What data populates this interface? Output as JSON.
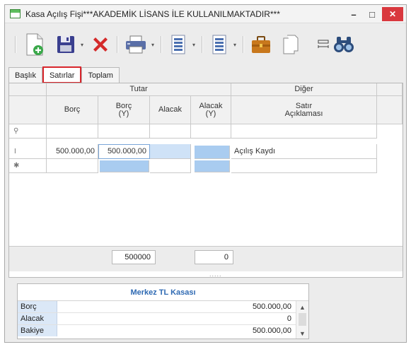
{
  "window": {
    "title": "Kasa Açılış Fişi***AKADEMİK LİSANS İLE KULLANILMAKTADIR***",
    "minimize": "–",
    "maximize": "□",
    "close": "✕"
  },
  "toolbar": {
    "icons": [
      "add-document-icon",
      "save-icon",
      "delete-icon",
      "print-icon",
      "document-list-icon",
      "document-list-icon",
      "briefcase-icon",
      "copy-icon",
      "ruler-icon",
      "binoculars-icon"
    ],
    "dropdown_glyph": "▾"
  },
  "tabs": [
    {
      "label": "Başlık",
      "active": false
    },
    {
      "label": "Satırlar",
      "active": true
    },
    {
      "label": "Toplam",
      "active": false
    }
  ],
  "grid": {
    "group_headers": {
      "tutar": "Tutar",
      "diger": "Diğer"
    },
    "columns": {
      "borc": "Borç",
      "borc_y": "Borç\n(Y)",
      "alacak": "Alacak",
      "alacak_y": "Alacak\n(Y)",
      "aciklama": "Satır\nAçıklaması"
    },
    "row_indicators": {
      "filter": "⚲",
      "editing": "I",
      "new": "✱"
    },
    "rows": [
      {
        "borc": "500.000,00",
        "borc_y": "500.000,00",
        "alacak": "",
        "alacak_y": "",
        "aciklama": "Açılış Kaydı"
      }
    ],
    "totals": {
      "borc_y": "500000",
      "alacak_y": "0"
    },
    "splitter": "....."
  },
  "bottom_panel": {
    "title": "Merkez TL Kasası",
    "rows": [
      {
        "label": "Borç",
        "value": "500.000,00"
      },
      {
        "label": "Alacak",
        "value": "0"
      },
      {
        "label": "Bakiye",
        "value": "500.000,00"
      }
    ],
    "scroll_up": "▲",
    "scroll_down": "▼"
  },
  "colors": {
    "close_button": "#d9383e",
    "tab_highlight": "#d8262c",
    "selected_cell": "#cfe2f7",
    "panel_title": "#2f6ab3",
    "label_bg": "#dbe8f7"
  }
}
